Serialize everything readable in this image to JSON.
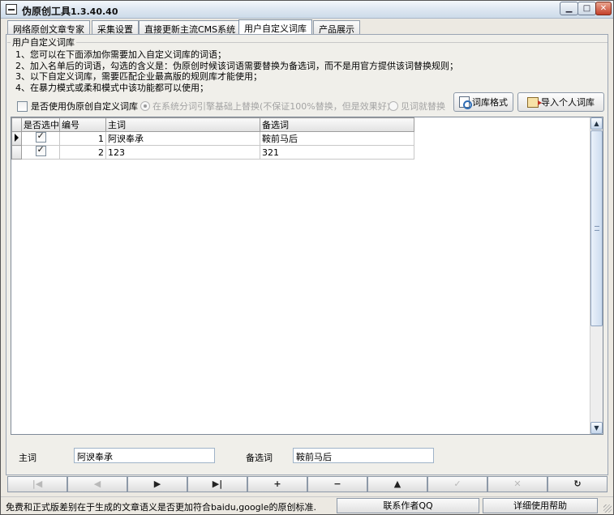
{
  "window": {
    "title": "伪原创工具",
    "version": "1.3.40.40"
  },
  "tabs": [
    {
      "label": "网络原创文章专家"
    },
    {
      "label": "采集设置"
    },
    {
      "label": "直接更新主流CMS系统"
    },
    {
      "label": "用户自定义词库"
    },
    {
      "label": "产品展示"
    }
  ],
  "group": {
    "title": "用户自定义词库",
    "notes": [
      "1、您可以在下面添加你需要加入自定义词库的词语；",
      "2、加入名单后的词语，勾选的含义是：伪原创时候该词语需要替换为备选词，而不是用官方提供该词替换规则；",
      "3、以下自定义词库，需要匹配企业最高版的规则库才能使用；",
      "4、在暴力模式或柔和模式中该功能都可以使用；"
    ]
  },
  "options": {
    "use_custom_label": "是否使用伪原创自定义词库",
    "use_custom_checked": false,
    "radio_system": "在系统分词引擎基础上替换(不保证100%替换，但是效果好)",
    "radio_direct": "见词就替换"
  },
  "buttons": {
    "format": "词库格式",
    "import": "导入个人词库"
  },
  "grid": {
    "columns": [
      "是否选中",
      "编号",
      "主词",
      "备选词"
    ],
    "rows": [
      {
        "selected": true,
        "id": "1",
        "main": "阿谀奉承",
        "alt": "鞍前马后"
      },
      {
        "selected": true,
        "id": "2",
        "main": "123",
        "alt": "321"
      }
    ]
  },
  "editor": {
    "main_label": "主词",
    "main_value": "阿谀奉承",
    "alt_label": "备选词",
    "alt_value": "鞍前马后"
  },
  "navigator": {
    "buttons": [
      "|◀",
      "◀",
      "▶",
      "▶|",
      "+",
      "−",
      "▲",
      "✓",
      "✕",
      "↻"
    ]
  },
  "status": {
    "text": "免费和正式版差别在于生成的文章语义是否更加符合baidu,google的原创标准.",
    "contact": "联系作者QQ",
    "help": "详细使用帮助"
  }
}
